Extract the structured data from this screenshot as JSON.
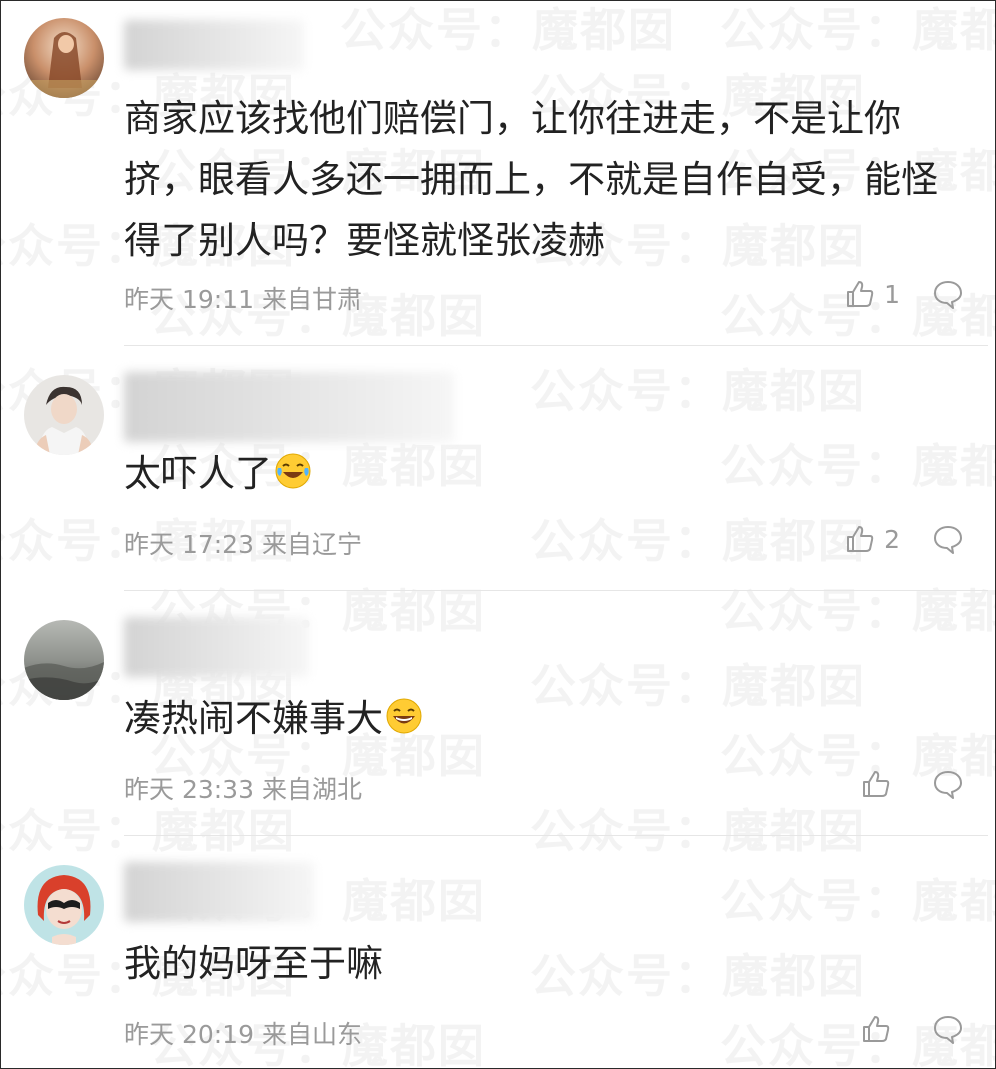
{
  "watermark_text": "公众号：魔都囡",
  "comments": [
    {
      "text": "商家应该找他们赔偿门，让你往进走，不是让你挤，眼看人多还一拥而上，不就是自作自受，能怪得了别人吗？要怪就怪张凌赫",
      "emoji": "",
      "time": "昨天 19:11",
      "location": "来自甘肃",
      "likes": "1"
    },
    {
      "text": "太吓人了",
      "emoji": "crying-laughing-emoji",
      "time": "昨天 17:23",
      "location": "来自辽宁",
      "likes": "2"
    },
    {
      "text": "凑热闹不嫌事大",
      "emoji": "laughing-emoji",
      "time": "昨天 23:33",
      "location": "来自湖北",
      "likes": ""
    },
    {
      "text": "我的妈呀至于嘛",
      "emoji": "",
      "time": "昨天 20:19",
      "location": "来自山东",
      "likes": ""
    }
  ],
  "colors": {
    "text": "#222222",
    "meta": "#9a9a9a",
    "divider": "#e6e6e6"
  }
}
